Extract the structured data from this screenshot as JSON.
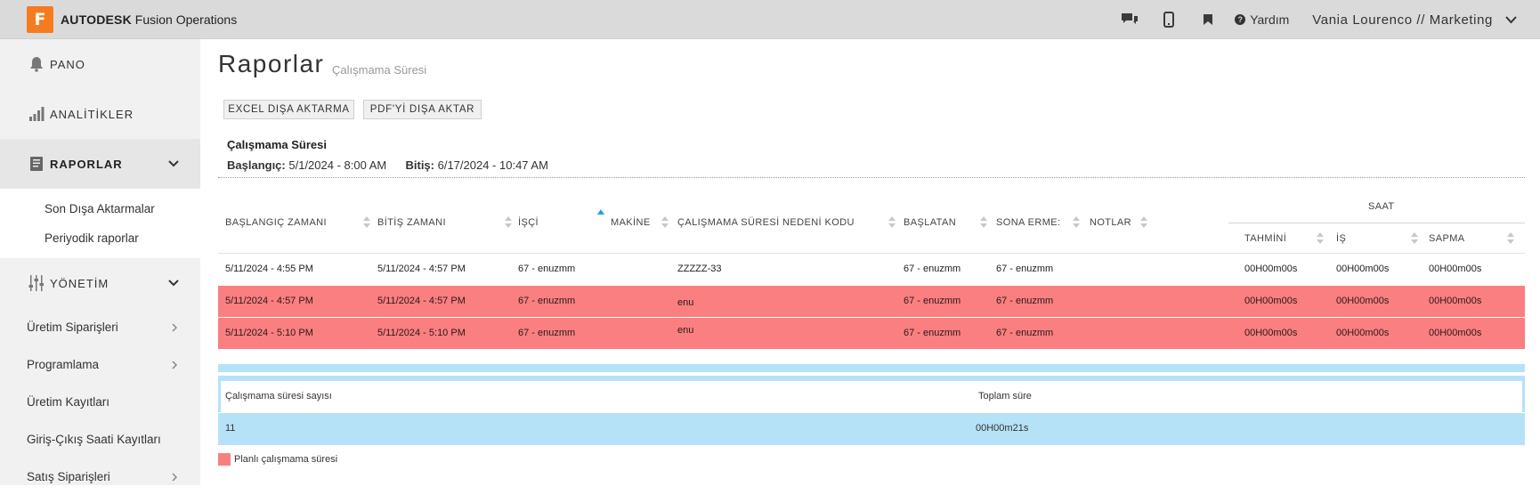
{
  "topbar": {
    "logo_letter": "F",
    "brand_bold": "AUTODESK",
    "brand_rest": "Fusion Operations",
    "help_label": "Yardım",
    "user_label": "Vania Lourenco // Marketing",
    "icons": [
      "chat-icon",
      "mobile-icon",
      "bookmark-icon",
      "help-icon",
      "chevron-down-icon"
    ]
  },
  "sidebar": {
    "main_items": [
      {
        "label": "PANO",
        "icon": "bell-icon"
      },
      {
        "label": "ANALİTİKLER",
        "icon": "bar-chart-icon"
      },
      {
        "label": "RAPORLAR",
        "icon": "report-icon"
      },
      {
        "label": "YÖNETİM",
        "icon": "sliders-icon"
      }
    ],
    "raporlar_sub": [
      "Son Dışa Aktarmalar",
      "Periyodik raporlar"
    ],
    "sections": [
      "Üretim Siparişleri",
      "Programlama",
      "Üretim Kayıtları",
      "Giriş-Çıkış Saati Kayıtları",
      "Satış Siparişleri"
    ]
  },
  "page": {
    "title": "Raporlar",
    "subtitle": "Çalışmama Süresi",
    "export_excel": "EXCEL DIŞA AKTARMA",
    "export_pdf": "PDF'Yİ DIŞA AKTAR",
    "report_name": "Çalışmama Süresi",
    "start_label": "Başlangıç:",
    "start_value": "5/1/2024 - 8:00 AM",
    "end_label": "Bitiş:",
    "end_value": "6/17/2024 - 10:47 AM"
  },
  "table": {
    "headers": {
      "start": "BAŞLANGIÇ ZAMANI",
      "end": "BİTİŞ ZAMANI",
      "worker": "İŞÇİ",
      "machine": "MAKİNE",
      "reason": "ÇALIŞMAMA SÜRESİ NEDENİ KODU",
      "started_by": "BAŞLATAN",
      "ended_by": "SONA ERME:",
      "notes": "NOTLAR",
      "group": "SAAT",
      "estimated": "TAHMİNİ",
      "work": "İŞ",
      "deviation": "SAPMA"
    },
    "rows": [
      {
        "start": "5/11/2024 - 4:55 PM",
        "end": "5/11/2024 - 4:57 PM",
        "worker": "67 - enuzmm",
        "machine": "",
        "reason": "ZZZZZ-33",
        "started_by": "67 - enuzmm",
        "ended_by": "67 - enuzmm",
        "notes": "",
        "estimated": "00H00m00s",
        "work": "00H00m00s",
        "deviation": "00H00m00s",
        "planned": false
      },
      {
        "start": "5/11/2024 - 4:57 PM",
        "end": "5/11/2024 - 4:57 PM",
        "worker": "67 - enuzmm",
        "machine": "",
        "reason": "enu",
        "started_by": "67 - enuzmm",
        "ended_by": "67 - enuzmm",
        "notes": "",
        "estimated": "00H00m00s",
        "work": "00H00m00s",
        "deviation": "00H00m00s",
        "planned": true
      },
      {
        "start": "5/11/2024 - 5:10 PM",
        "end": "5/11/2024 - 5:10 PM",
        "worker": "67 - enuzmm",
        "machine": "",
        "reason": "enu",
        "started_by": "67 - enuzmm",
        "ended_by": "67 - enuzmm",
        "notes": "",
        "estimated": "00H00m00s",
        "work": "00H00m00s",
        "deviation": "00H00m00s",
        "planned": true
      }
    ]
  },
  "summary": {
    "count_label": "Çalışmama süresi sayısı",
    "total_label": "Toplam süre",
    "count_value": "11",
    "total_value": "00H00m21s"
  },
  "legend": {
    "planned_label": "Planlı çalışmama süresi",
    "planned_color": "#fa7f80"
  },
  "colors": {
    "brand": "#f47b20",
    "summary_band": "#b5e2f7",
    "sort_active": "#2a9fd8"
  }
}
